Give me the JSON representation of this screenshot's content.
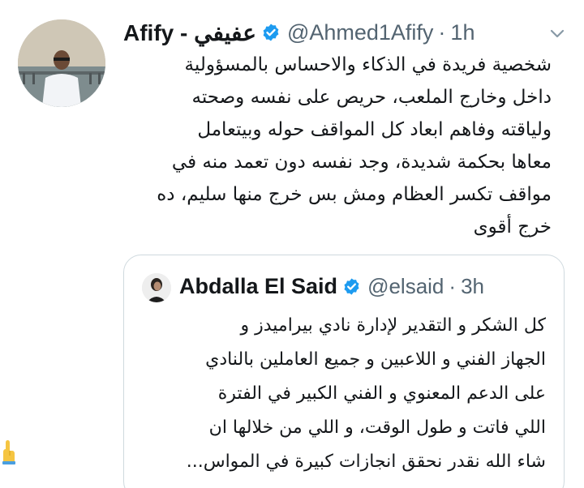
{
  "tweet": {
    "display_name": "Afify - عفيفي",
    "handle": "@Ahmed1Afify",
    "separator": "·",
    "time": "1h",
    "verified": true,
    "body_lines": [
      "شخصية فريدة في الذكاء والاحساس بالمسؤولية",
      "داخل وخارج الملعب، حريص على نفسه وصحته",
      "ولياقته وفاهم ابعاد كل المواقف حوله وبيتعامل",
      "معاها بحكمة شديدة، وجد نفسه دون تعمد منه في",
      "مواقف تكسر العظام ومش بس خرج منها سليم، ده",
      "خرج أقوى"
    ]
  },
  "quoted_tweet": {
    "display_name": "Abdalla El Said",
    "handle": "@elsaid",
    "separator": "·",
    "time": "3h",
    "verified": true,
    "body_lines": [
      "كل الشكر و التقدير لإدارة نادي بيراميدز و",
      "الجهاز الفني و اللاعبين و جميع العاملين بالنادي",
      "على الدعم المعنوي و الفني الكبير في الفترة",
      "اللي فاتت و طول الوقت، و اللي من خلالها ان",
      "شاء الله نقدر نحقق انجازات كبيرة في المواس..."
    ]
  },
  "icons": {
    "verified": "verified-badge-icon",
    "more": "chevron-down-icon",
    "emoji": "hand-emoji-icon"
  },
  "colors": {
    "verified_blue": "#1d9bf0",
    "secondary_text": "#536471",
    "border": "#cfd9de"
  }
}
